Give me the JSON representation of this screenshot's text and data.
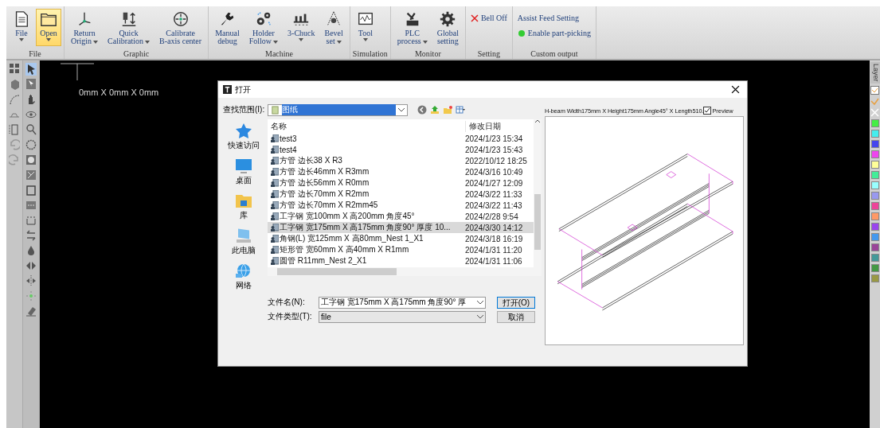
{
  "ribbon": {
    "groups": [
      {
        "label": "File",
        "buttons": [
          {
            "kind": "large",
            "label": "File",
            "dropdown": true,
            "selected": false
          },
          {
            "kind": "large",
            "label": "Open",
            "dropdown": true,
            "selected": true
          }
        ]
      },
      {
        "label": "Graphic",
        "buttons": [
          {
            "kind": "large",
            "label": "Return\nOrigin",
            "dropdown": true,
            "selected": false
          },
          {
            "kind": "large",
            "label": "Quick\nCalibration",
            "dropdown": true,
            "selected": false
          },
          {
            "kind": "large",
            "label": "Calibrate\nB-axis center",
            "dropdown": false,
            "selected": false
          }
        ]
      },
      {
        "label": "Machine",
        "buttons": [
          {
            "kind": "large",
            "label": "Manual\ndebug",
            "dropdown": false,
            "selected": false
          },
          {
            "kind": "large",
            "label": "Holder\nFollow",
            "dropdown": true,
            "selected": false
          },
          {
            "kind": "large",
            "label": "3-Chuck",
            "dropdown": true,
            "selected": false
          },
          {
            "kind": "large",
            "label": "Bevel\nset",
            "dropdown": true,
            "selected": false
          }
        ]
      },
      {
        "label": "Simulation",
        "buttons": [
          {
            "kind": "large",
            "label": "Tool",
            "dropdown": true,
            "selected": false
          }
        ]
      },
      {
        "label": "Monitor",
        "buttons": [
          {
            "kind": "large",
            "label": "PLC\nprocess",
            "dropdown": true,
            "selected": false
          },
          {
            "kind": "large",
            "label": "Global\nsetting",
            "dropdown": false,
            "selected": false
          }
        ]
      },
      {
        "label": "Setting",
        "buttons": [
          {
            "kind": "small",
            "label": "Bell Off"
          }
        ]
      },
      {
        "label": "Custom output",
        "buttons": [
          {
            "kind": "small",
            "label": "Assist Feed Setting"
          },
          {
            "kind": "small",
            "label": "Enable part-picking"
          }
        ]
      }
    ]
  },
  "canvas": {
    "dimensions": "0mm X 0mm X 0mm"
  },
  "dialog": {
    "title": "打开",
    "look_in": {
      "label": "查找范围(I):",
      "value": "图纸"
    },
    "places": [
      {
        "label": "快速访问"
      },
      {
        "label": "桌面"
      },
      {
        "label": "库"
      },
      {
        "label": "此电脑"
      },
      {
        "label": "网络"
      }
    ],
    "columns": [
      "名称",
      "修改日期"
    ],
    "rows": [
      {
        "name": "test3",
        "date": "2024/1/23 15:34",
        "selected": false
      },
      {
        "name": "test4",
        "date": "2024/1/23 15:43",
        "selected": false
      },
      {
        "name": "方管 边长38 X R3",
        "date": "2022/10/12 18:25",
        "selected": false
      },
      {
        "name": "方管 边长46mm X R3mm",
        "date": "2024/3/16 10:49",
        "selected": false
      },
      {
        "name": "方管 边长56mm X R0mm",
        "date": "2024/1/27 12:09",
        "selected": false
      },
      {
        "name": "方管 边长70mm X R2mm",
        "date": "2024/3/22 11:33",
        "selected": false
      },
      {
        "name": "方管 边长70mm X R2mm45",
        "date": "2024/3/22 11:43",
        "selected": false
      },
      {
        "name": "工字钢 宽100mm X 高200mm 角度45°",
        "date": "2024/2/28 9:54",
        "selected": false
      },
      {
        "name": "工字钢 宽175mm X 高175mm 角度90° 厚度 10...",
        "date": "2024/3/30 14:12",
        "selected": true
      },
      {
        "name": "角钢(L) 宽125mm X 高80mm_Nest 1_X1",
        "date": "2024/3/18 16:19",
        "selected": false
      },
      {
        "name": "矩形管 宽60mm X 高40mm X R1mm",
        "date": "2024/1/31 11:20",
        "selected": false
      },
      {
        "name": "圆管 R11mm_Nest 2_X1",
        "date": "2024/1/31 11:06",
        "selected": false
      }
    ],
    "file_name": {
      "label": "文件名(N):",
      "value": "工字钢 宽175mm X 高175mm 角度90° 厚"
    },
    "file_type": {
      "label": "文件类型(T):",
      "value": "file"
    },
    "buttons": [
      {
        "label": "打开(O)",
        "default": true
      },
      {
        "label": "取消",
        "default": false
      }
    ],
    "preview": {
      "caption": "H-beam Width175mm X Height175mm Angle45° X Length510.",
      "checkbox": {
        "label": "Preview",
        "checked": true
      }
    }
  },
  "layer_panel": {
    "tab": "Layer",
    "colors": [
      {
        "color": "#44ee44"
      },
      {
        "color": "#44eeee"
      },
      {
        "color": "#4444ee"
      },
      {
        "color": "#ee44ee"
      },
      {
        "color": "#ffff99"
      },
      {
        "color": "#44ee99"
      },
      {
        "color": "#99ffff"
      },
      {
        "color": "#9999ee"
      },
      {
        "color": "#ee4499"
      },
      {
        "color": "#ff9966"
      },
      {
        "color": "#9944ee"
      },
      {
        "color": "#4499ee"
      },
      {
        "color": "#994499"
      },
      {
        "color": "#449999"
      },
      {
        "color": "#449944"
      },
      {
        "color": "#999944"
      }
    ]
  }
}
